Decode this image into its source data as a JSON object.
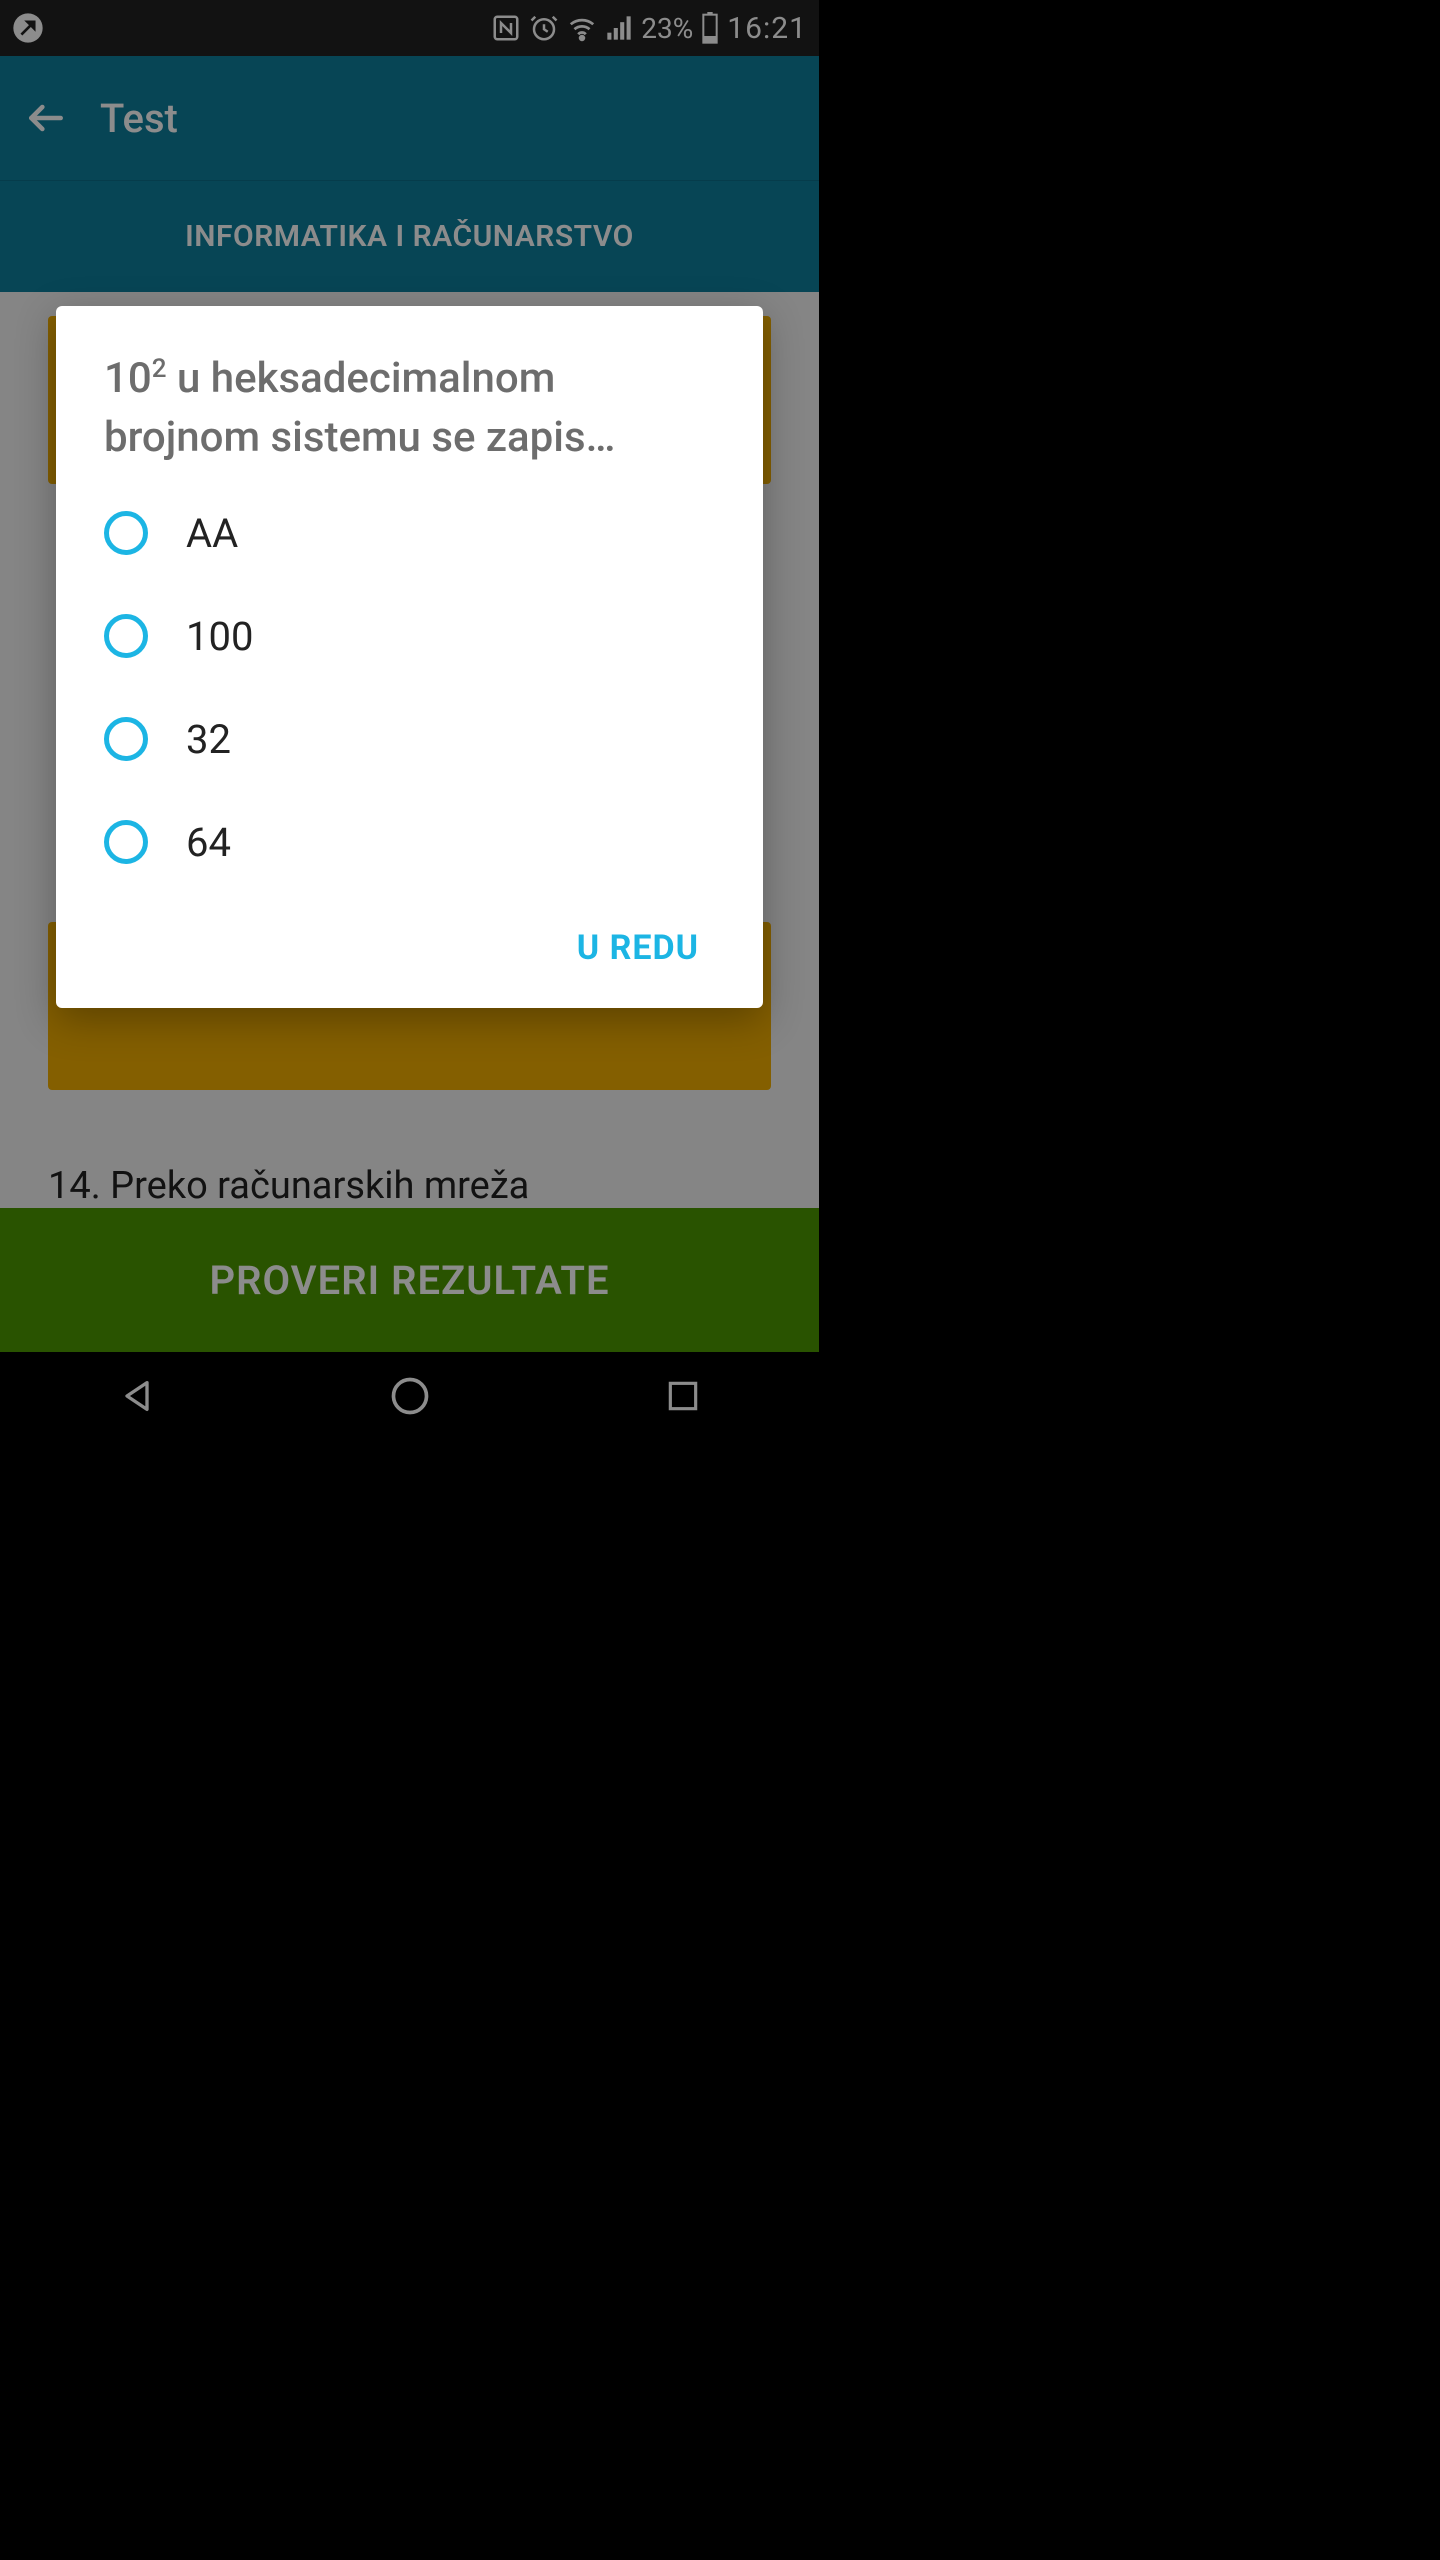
{
  "status": {
    "battery_percent": "23%",
    "time": "16:21"
  },
  "appbar": {
    "title": "Test"
  },
  "category": {
    "label": "INFORMATIKA I RAČUNARSTVO"
  },
  "background_question": {
    "number": "14.",
    "text": "Preko računarskih mreža"
  },
  "check_button": {
    "label": "PROVERI REZULTATE"
  },
  "dialog": {
    "title_base": "10",
    "title_sup": "2",
    "title_rest": " u heksadecimalnom brojnom sistemu se zapis…",
    "options": [
      "AA",
      "100",
      "32",
      "64"
    ],
    "ok_label": "U REDU"
  }
}
